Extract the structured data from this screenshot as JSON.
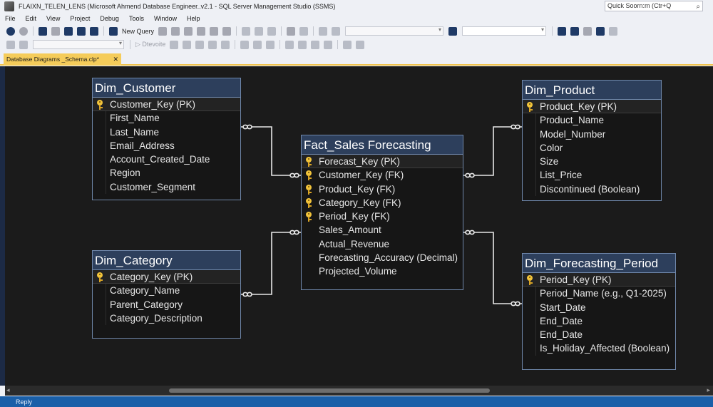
{
  "window": {
    "title": "FLAIXN_TELEN_LENS (Microsoft Ahmend Database Engineer..v2.1 - SQL Server Management Studio (SSMS)",
    "quick_launch_placeholder": "Quick Soorn:m (Ctr+Q"
  },
  "menu": [
    "File",
    "Edit",
    "View",
    "Project",
    "Debug",
    "Tools",
    "Window",
    "Help"
  ],
  "toolbar": {
    "new_query_label": "New Query",
    "execute_label": "Dtevoite"
  },
  "document_tab": {
    "label": "Database Diagrams _Schema.clp*"
  },
  "status": {
    "text": "Reply"
  },
  "tables": {
    "dim_customer": {
      "title": "Dim_Customer",
      "key": "Customer_Key (PK)",
      "columns": [
        "First_Name",
        "Last_Name",
        "Email_Address",
        "Account_Created_Date",
        "Region",
        "Customer_Segment"
      ]
    },
    "dim_category": {
      "title": "Dim_Category",
      "key": "Category_Key (PK)",
      "columns": [
        "Category_Name",
        "Parent_Category",
        "Category_Description"
      ]
    },
    "fact_sales": {
      "title": "Fact_Sales Forecasting",
      "key": "Forecast_Key (PK)",
      "foreign_keys": [
        "Customer_Key (FK)",
        "Product_Key (FK)",
        "Category_Key (FK)",
        "Period_Key (FK)"
      ],
      "columns": [
        "Sales_Amount",
        "Actual_Revenue",
        "Forecasting_Accuracy (Decimal)",
        "Projected_Volume"
      ]
    },
    "dim_product": {
      "title": "Dim_Product",
      "key": "Product_Key (PK)",
      "columns": [
        "Product_Name",
        "Model_Number",
        "Color",
        "Size",
        "List_Price",
        "Discontinued (Boolean)"
      ]
    },
    "dim_period": {
      "title": "Dim_Forecasting_Period",
      "key": "Period_Key (PK)",
      "columns": [
        "Period_Name (e.g., Q1-2025)",
        "Start_Date",
        "End_Date",
        "End_Date",
        "Is_Holiday_Affected (Boolean)"
      ]
    }
  },
  "colors": {
    "canvas": "#1b1b1b",
    "table_header": "#2d3f5c",
    "table_border": "#6f87aa",
    "key_icon": "#f1c33b",
    "tab_active": "#f5cc5a",
    "status_bar": "#1a5fa8"
  }
}
